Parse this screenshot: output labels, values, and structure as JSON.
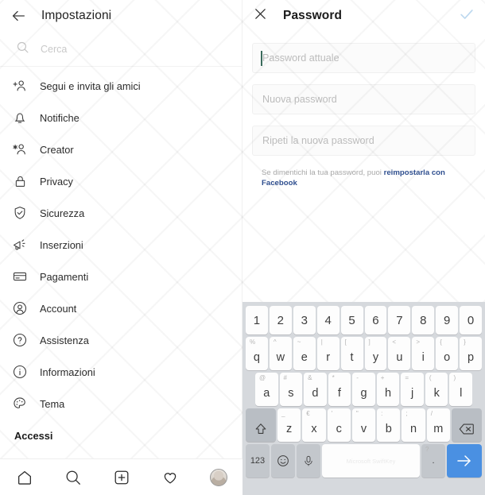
{
  "left": {
    "header": {
      "title": "Impostazioni",
      "back_icon": "back-arrow-icon"
    },
    "search": {
      "placeholder": "Cerca",
      "icon": "search-icon"
    },
    "menu": [
      {
        "label": "Segui e invita gli amici",
        "icon": "add-person-icon"
      },
      {
        "label": "Notifiche",
        "icon": "bell-icon"
      },
      {
        "label": "Creator",
        "icon": "creator-person-icon"
      },
      {
        "label": "Privacy",
        "icon": "lock-icon"
      },
      {
        "label": "Sicurezza",
        "icon": "shield-check-icon"
      },
      {
        "label": "Inserzioni",
        "icon": "megaphone-icon"
      },
      {
        "label": "Pagamenti",
        "icon": "credit-card-icon"
      },
      {
        "label": "Account",
        "icon": "account-circle-icon"
      },
      {
        "label": "Assistenza",
        "icon": "help-circle-icon"
      },
      {
        "label": "Informazioni",
        "icon": "info-circle-icon"
      },
      {
        "label": "Tema",
        "icon": "palette-icon"
      }
    ],
    "section_label": "Accessi",
    "bottom_nav": [
      {
        "name": "home",
        "icon": "home-icon"
      },
      {
        "name": "search",
        "icon": "search-icon"
      },
      {
        "name": "create",
        "icon": "plus-square-icon"
      },
      {
        "name": "activity",
        "icon": "heart-icon"
      },
      {
        "name": "profile",
        "icon": "avatar-icon"
      }
    ]
  },
  "right": {
    "header": {
      "title": "Password",
      "close_icon": "close-x-icon",
      "confirm_icon": "check-icon",
      "confirm_color": "#bcd8ef"
    },
    "fields": [
      {
        "placeholder": "Password attuale",
        "value": "",
        "focused": true
      },
      {
        "placeholder": "Nuova password",
        "value": "",
        "focused": false
      },
      {
        "placeholder": "Ripeti la nuova password",
        "value": "",
        "focused": false
      }
    ],
    "helper": {
      "text": "Se dimentichi la tua password, puoi ",
      "link": "reimpostarla con Facebook",
      "link_color": "#2f4f8f"
    }
  },
  "keyboard": {
    "brand": "Microsoft SwiftKey",
    "numbers": [
      "1",
      "2",
      "3",
      "4",
      "5",
      "6",
      "7",
      "8",
      "9",
      "0"
    ],
    "row_q": [
      {
        "key": "q",
        "sup": "%"
      },
      {
        "key": "w",
        "sup": "^"
      },
      {
        "key": "e",
        "sup": "~"
      },
      {
        "key": "r",
        "sup": "|"
      },
      {
        "key": "t",
        "sup": "["
      },
      {
        "key": "y",
        "sup": "]"
      },
      {
        "key": "u",
        "sup": "<"
      },
      {
        "key": "i",
        "sup": ">"
      },
      {
        "key": "o",
        "sup": "{"
      },
      {
        "key": "p",
        "sup": "}"
      }
    ],
    "row_a": [
      {
        "key": "a",
        "sup": "@"
      },
      {
        "key": "s",
        "sup": "#"
      },
      {
        "key": "d",
        "sup": "&"
      },
      {
        "key": "f",
        "sup": "*"
      },
      {
        "key": "g",
        "sup": "-"
      },
      {
        "key": "h",
        "sup": "+"
      },
      {
        "key": "j",
        "sup": "="
      },
      {
        "key": "k",
        "sup": "("
      },
      {
        "key": "l",
        "sup": ")"
      }
    ],
    "row_z": [
      {
        "key": "z",
        "sup": "_"
      },
      {
        "key": "x",
        "sup": "€"
      },
      {
        "key": "c",
        "sup": "'"
      },
      {
        "key": "v",
        "sup": "\""
      },
      {
        "key": "b",
        "sup": ":"
      },
      {
        "key": "n",
        "sup": ";"
      },
      {
        "key": "m",
        "sup": "/"
      }
    ],
    "shift_icon": "shift-up-icon",
    "backspace_icon": "backspace-icon",
    "numeric_label": "123",
    "emoji_icon": "emoji-smiley-icon",
    "mic_icon": "microphone-icon",
    "punct": {
      "sup": "?",
      "key": "."
    },
    "enter_icon": "enter-arrow-icon",
    "enter_color": "#4a90e2"
  }
}
